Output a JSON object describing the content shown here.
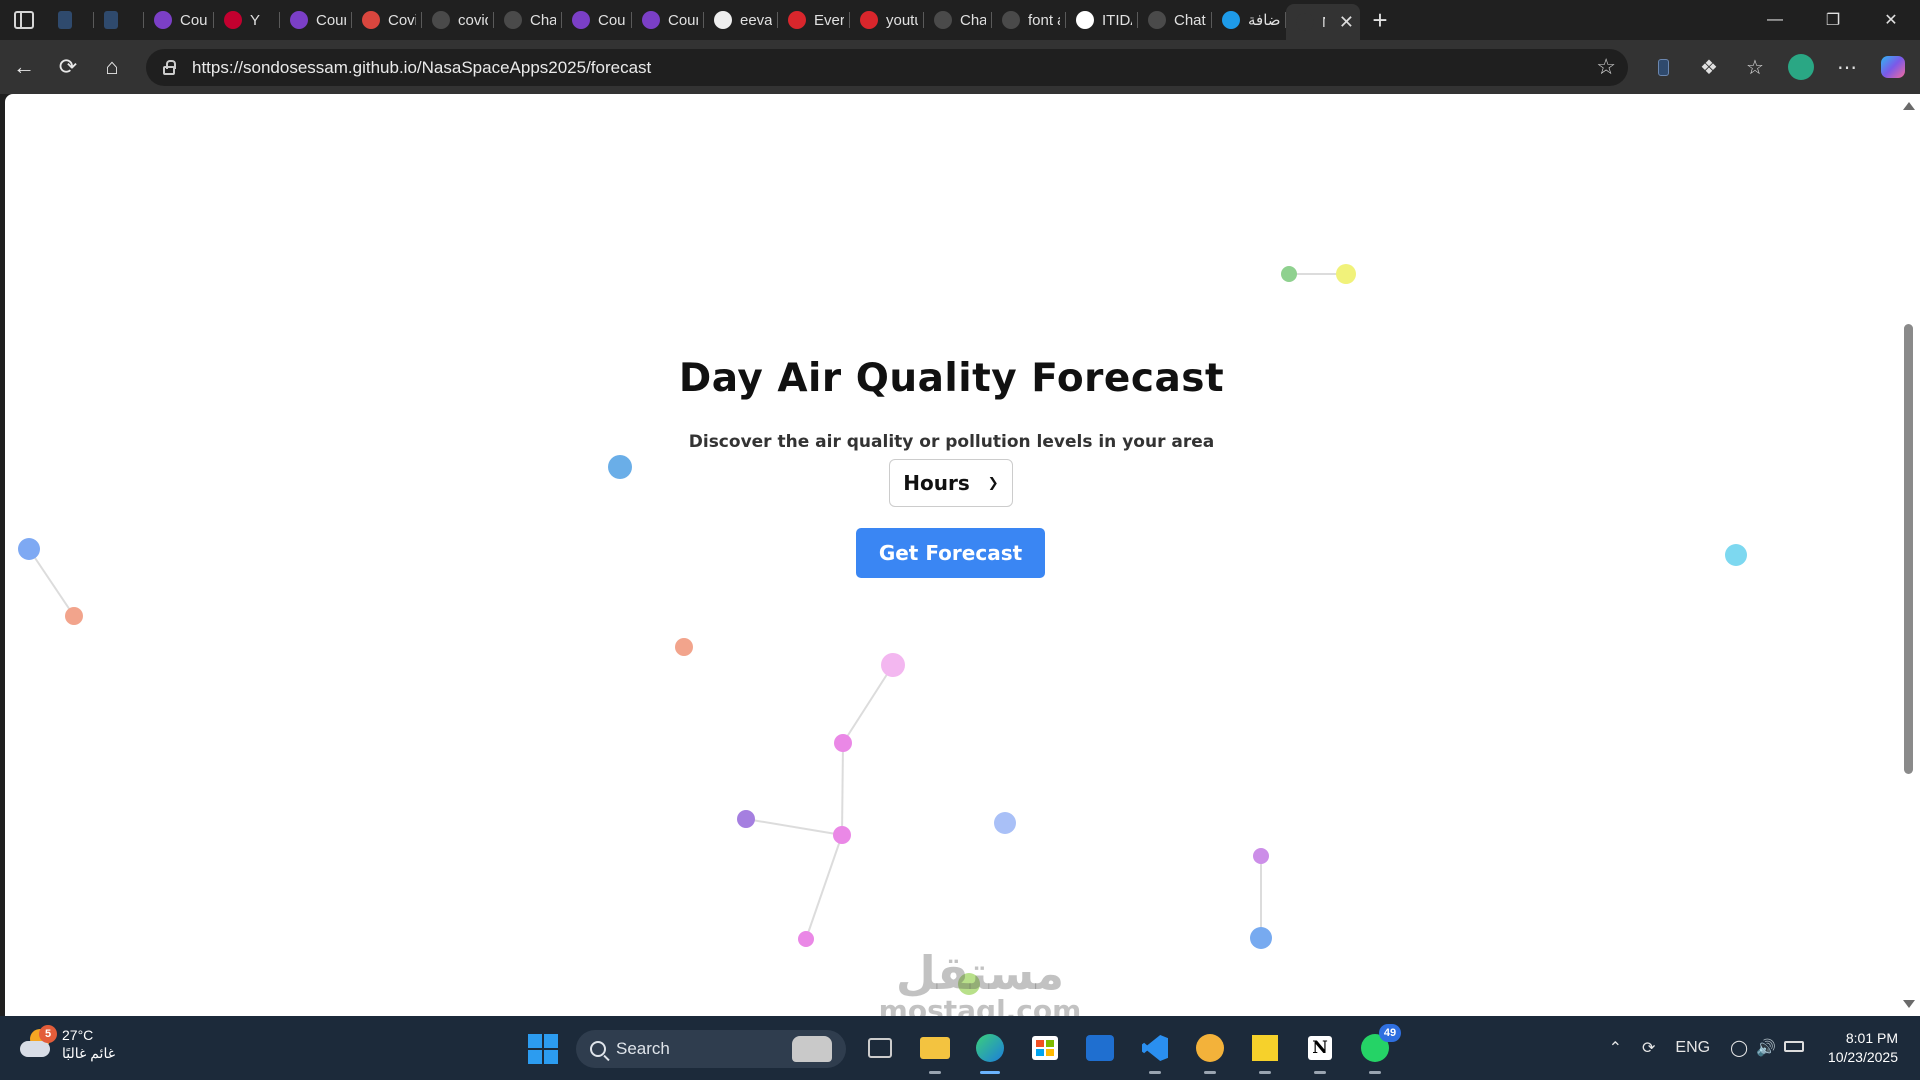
{
  "browser": {
    "tabs": [
      {
        "title": "",
        "icon": "document-icon",
        "color": "#2f4a6d"
      },
      {
        "title": "",
        "icon": "document-icon",
        "color": "#2f4a6d"
      },
      {
        "title": "Course",
        "icon": "udemy-icon",
        "color": "#7b3fc6"
      },
      {
        "title": "Y",
        "icon": "angular-icon",
        "color": "#c3002f"
      },
      {
        "title": "Course",
        "icon": "udemy-icon",
        "color": "#7b3fc6"
      },
      {
        "title": "Covid",
        "icon": "covid-icon",
        "color": "#d9463e"
      },
      {
        "title": "covid",
        "icon": "search-icon",
        "color": "#4a4a4a"
      },
      {
        "title": "ChatG",
        "icon": "chatgpt-icon",
        "color": "#4a4a4a"
      },
      {
        "title": "Course",
        "icon": "udemy-icon",
        "color": "#7b3fc6"
      },
      {
        "title": "Course",
        "icon": "udemy-icon",
        "color": "#7b3fc6"
      },
      {
        "title": "eevan",
        "icon": "github-icon",
        "color": "#eeeeee"
      },
      {
        "title": "Every",
        "icon": "youtube-icon",
        "color": "#d9262c"
      },
      {
        "title": "youtub",
        "icon": "youtube-icon",
        "color": "#d9262c"
      },
      {
        "title": "ChatG",
        "icon": "chatgpt-icon",
        "color": "#4a4a4a"
      },
      {
        "title": "font av",
        "icon": "search-icon",
        "color": "#4a4a4a"
      },
      {
        "title": "ITIDA",
        "icon": "itida-icon",
        "color": "#ffffff"
      },
      {
        "title": "ChatG",
        "icon": "chatgpt-icon",
        "color": "#4a4a4a"
      },
      {
        "title": "إضافة",
        "icon": "extension-ring-icon",
        "color": "#1e9be9"
      },
      {
        "title": "N",
        "icon": "nasa-icon",
        "color": "#333333",
        "active": true
      }
    ],
    "url": "https://sondosessam.github.io/NasaSpaceApps2025/forecast"
  },
  "page": {
    "title": "Day Air Quality Forecast",
    "subtitle": "Discover the air quality or pollution levels in your area",
    "select": {
      "selected": "Hours"
    },
    "button_label": "Get Forecast",
    "accent": "#3a86f3"
  },
  "particles": {
    "colors": [
      "#6aaee8",
      "#f2a48c",
      "#f3b7f0",
      "#ea88e6",
      "#a57fe0",
      "#a9c0f7",
      "#8fd18f",
      "#f1f27a",
      "#7dd8f0",
      "#7ea9f3",
      "#cc8ee8",
      "#77aaf0",
      "#b8e08a"
    ]
  },
  "watermark": {
    "arabic": "مستقل",
    "latin": "mostaql.com"
  },
  "taskbar": {
    "weather_temp": "27°C",
    "weather_desc": "غائم غالبًا",
    "weather_badge": "5",
    "search_label": "Search",
    "whatsapp_badge": "49",
    "language": "ENG",
    "time": "8:01 PM",
    "date": "10/23/2025"
  }
}
